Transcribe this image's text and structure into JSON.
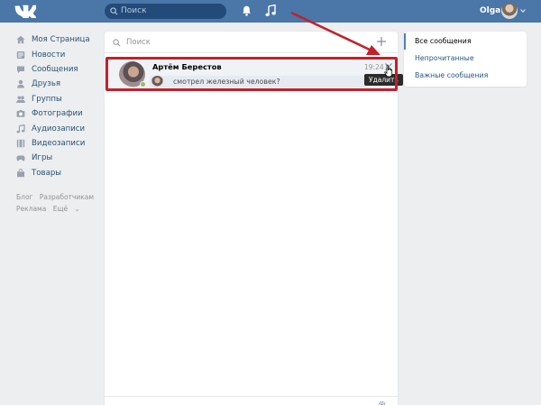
{
  "header": {
    "search_placeholder": "Поиск",
    "user_name": "Olga"
  },
  "sidebar": {
    "items": [
      {
        "label": "Моя Страница",
        "icon": "home-icon"
      },
      {
        "label": "Новости",
        "icon": "news-icon"
      },
      {
        "label": "Сообщения",
        "icon": "messages-icon"
      },
      {
        "label": "Друзья",
        "icon": "friends-icon"
      },
      {
        "label": "Группы",
        "icon": "groups-icon"
      },
      {
        "label": "Фотографии",
        "icon": "photos-icon"
      },
      {
        "label": "Аудиозаписи",
        "icon": "audio-icon"
      },
      {
        "label": "Видеозаписи",
        "icon": "video-icon"
      },
      {
        "label": "Игры",
        "icon": "games-icon"
      },
      {
        "label": "Товары",
        "icon": "goods-icon"
      }
    ],
    "footer": {
      "blog": "Блог",
      "developers": "Разработчикам",
      "ads": "Реклама",
      "more": "Ещё"
    }
  },
  "dialogs": {
    "search_placeholder": "Поиск",
    "rows": [
      {
        "name": "Артём Берестов",
        "time": "19:24",
        "message": "смотрел железный человек?"
      }
    ],
    "delete_tooltip": "Удалить"
  },
  "filters": {
    "items": [
      {
        "label": "Все сообщения"
      },
      {
        "label": "Непрочитанные"
      },
      {
        "label": "Важные сообщения"
      }
    ]
  },
  "colors": {
    "header": "#4a76a8",
    "accent": "#5181b8",
    "highlight": "#c4202a"
  }
}
